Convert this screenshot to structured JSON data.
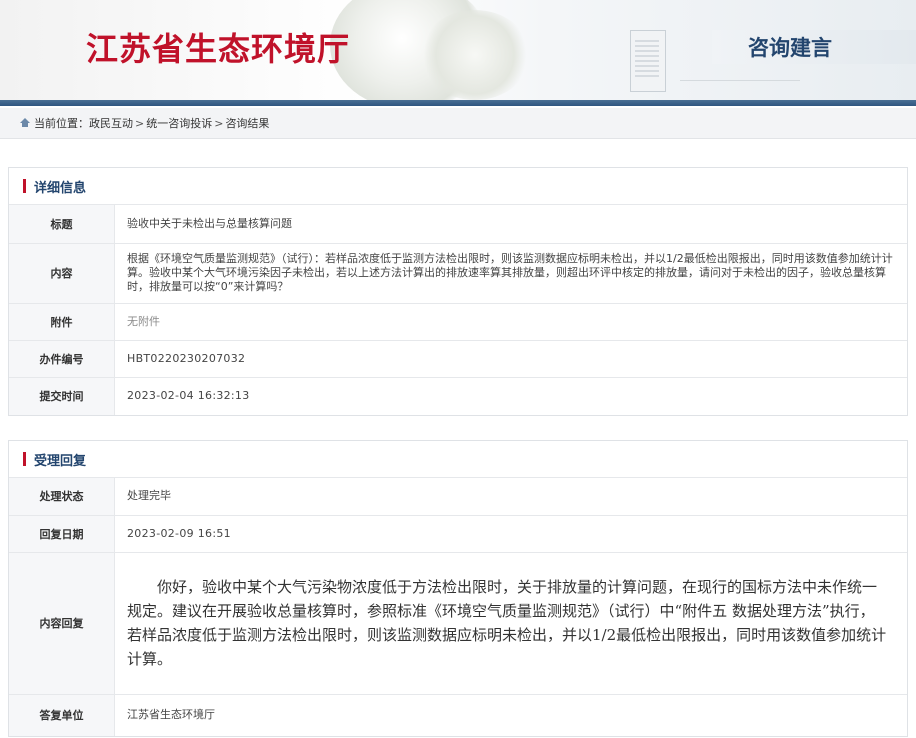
{
  "header": {
    "site_title": "江苏省生态环境厅",
    "section_tab": "咨询建言",
    "accent_color": "#c0122a",
    "brand_blue": "#2f5680"
  },
  "breadcrumb": {
    "prefix": "当前位置：",
    "items": [
      "政民互动",
      "统一咨询投诉",
      "咨询结果"
    ],
    "separator": ">"
  },
  "details": {
    "title": "详细信息",
    "rows": [
      {
        "label": "标题",
        "value": "验收中关于未检出与总量核算问题"
      },
      {
        "label": "内容",
        "value": "根据《环境空气质量监测规范》（试行）：若样品浓度低于监测方法检出限时，则该监测数据应标明未检出，并以1/2最低检出限报出，同时用该数值参加统计计算。验收中某个大气环境污染因子未检出，若以上述方法计算出的排放速率算其排放量，则超出环评中核定的排放量，请问对于未检出的因子，验收总量核算时，排放量可以按“0”来计算吗？"
      },
      {
        "label": "附件",
        "value": "无附件"
      },
      {
        "label": "办件编号",
        "value": "HBT0220230207032"
      },
      {
        "label": "提交时间",
        "value": "2023-02-04 16:32:13"
      }
    ]
  },
  "reply": {
    "title": "受理回复",
    "rows": [
      {
        "label": "处理状态",
        "value": "处理完毕"
      },
      {
        "label": "回复日期",
        "value": "2023-02-09 16:51"
      },
      {
        "label": "内容回复",
        "value": "你好，验收中某个大气污染物浓度低于方法检出限时，关于排放量的计算问题，在现行的国标方法中未作统一规定。建议在开展验收总量核算时，参照标准《环境空气质量监测规范》（试行）中“附件五 数据处理方法”执行，若样品浓度低于监测方法检出限时，则该监测数据应标明未检出，并以1/2最低检出限报出，同时用该数值参加统计计算。"
      },
      {
        "label": "答复单位",
        "value": "江苏省生态环境厅"
      }
    ]
  }
}
